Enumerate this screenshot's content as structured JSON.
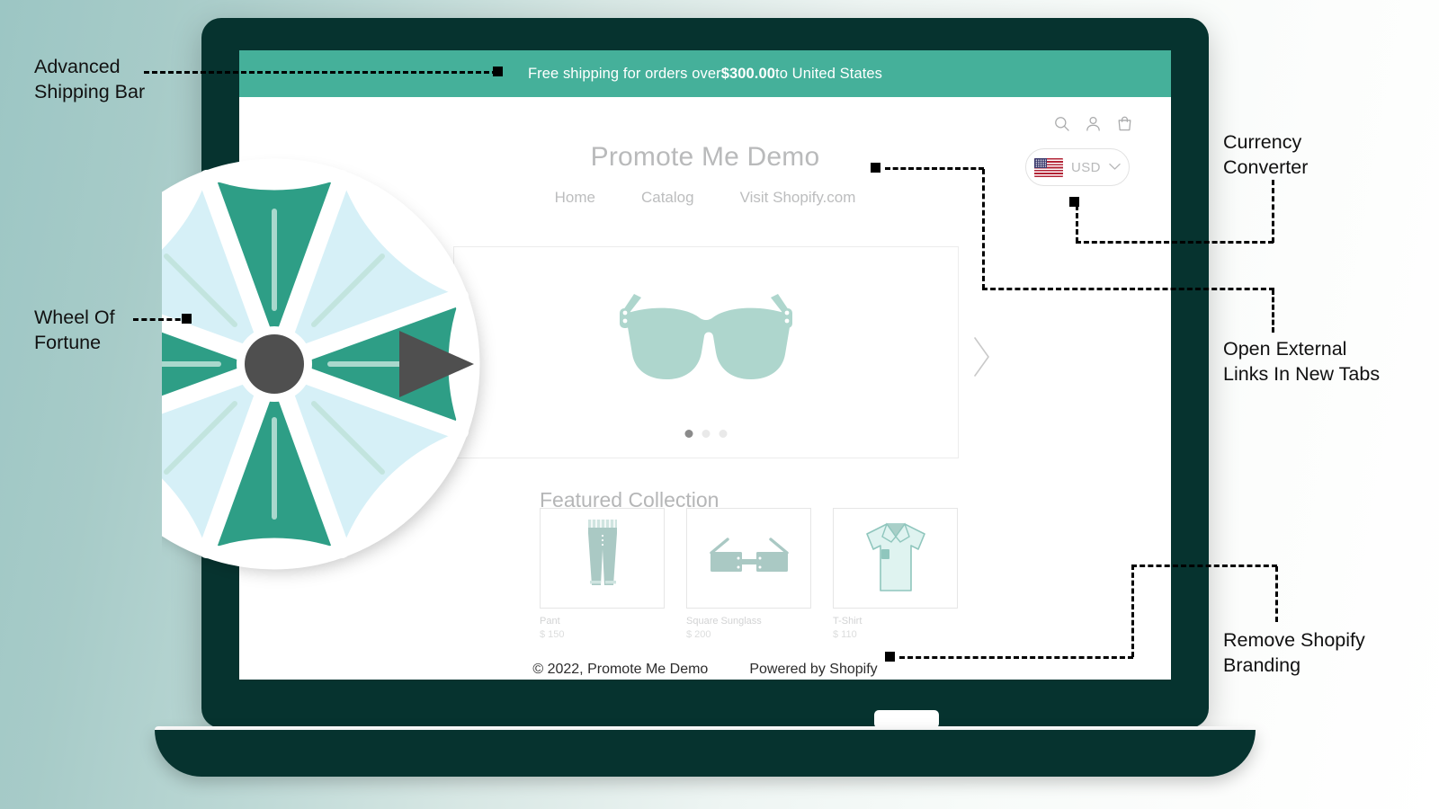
{
  "annotations": [
    {
      "id": "advanced-shipping-bar",
      "label": "Advanced\nShipping Bar"
    },
    {
      "id": "wheel-of-fortune",
      "label": "Wheel Of\nFortune"
    },
    {
      "id": "currency-converter",
      "label": "Currency\nConverter"
    },
    {
      "id": "open-external-links",
      "label": "Open External\nLinks In New Tabs"
    },
    {
      "id": "remove-shopify-branding",
      "label": "Remove Shopify\nBranding"
    }
  ],
  "shipping_bar": {
    "prefix": "Free shipping for orders over ",
    "amount": "$300.00",
    "suffix": " to United States"
  },
  "store": {
    "title": "Promote Me Demo",
    "nav": [
      {
        "label": "Home",
        "name": "nav-home"
      },
      {
        "label": "Catalog",
        "name": "nav-catalog"
      },
      {
        "label": "Visit Shopify.com",
        "name": "nav-visit-shopify"
      }
    ],
    "icons": [
      {
        "name": "search-icon"
      },
      {
        "name": "account-icon"
      },
      {
        "name": "cart-icon"
      }
    ],
    "currency": {
      "code": "USD",
      "flag": "us-flag-icon",
      "caret": "chevron-down-icon"
    },
    "hero": {
      "image": "sunglasses-illustration",
      "dots": 3,
      "active_dot": 0,
      "next_label": "next-slide-arrow"
    },
    "featured": {
      "title": "Featured Collection",
      "products": [
        {
          "name": "Pant",
          "price": "$ 150",
          "icon": "pant-illustration"
        },
        {
          "name": "Square Sunglass",
          "price": "$ 200",
          "icon": "sunglass-illustration"
        },
        {
          "name": "T-Shirt",
          "price": "$ 110",
          "icon": "tshirt-illustration"
        }
      ]
    },
    "footer": {
      "copyright": "© 2022, Promote Me Demo",
      "powered_by": "Powered by Shopify"
    }
  },
  "colors": {
    "accent_teal": "#45b09a",
    "wheel_teal": "#2e9e86",
    "wheel_light": "#d6f0f7",
    "laptop_dark": "#06332f",
    "hub_gray": "#4f4f4f"
  },
  "wheel": {
    "name": "wheel-of-fortune-graphic",
    "segments": 8,
    "pointer": "wheel-pointer"
  }
}
